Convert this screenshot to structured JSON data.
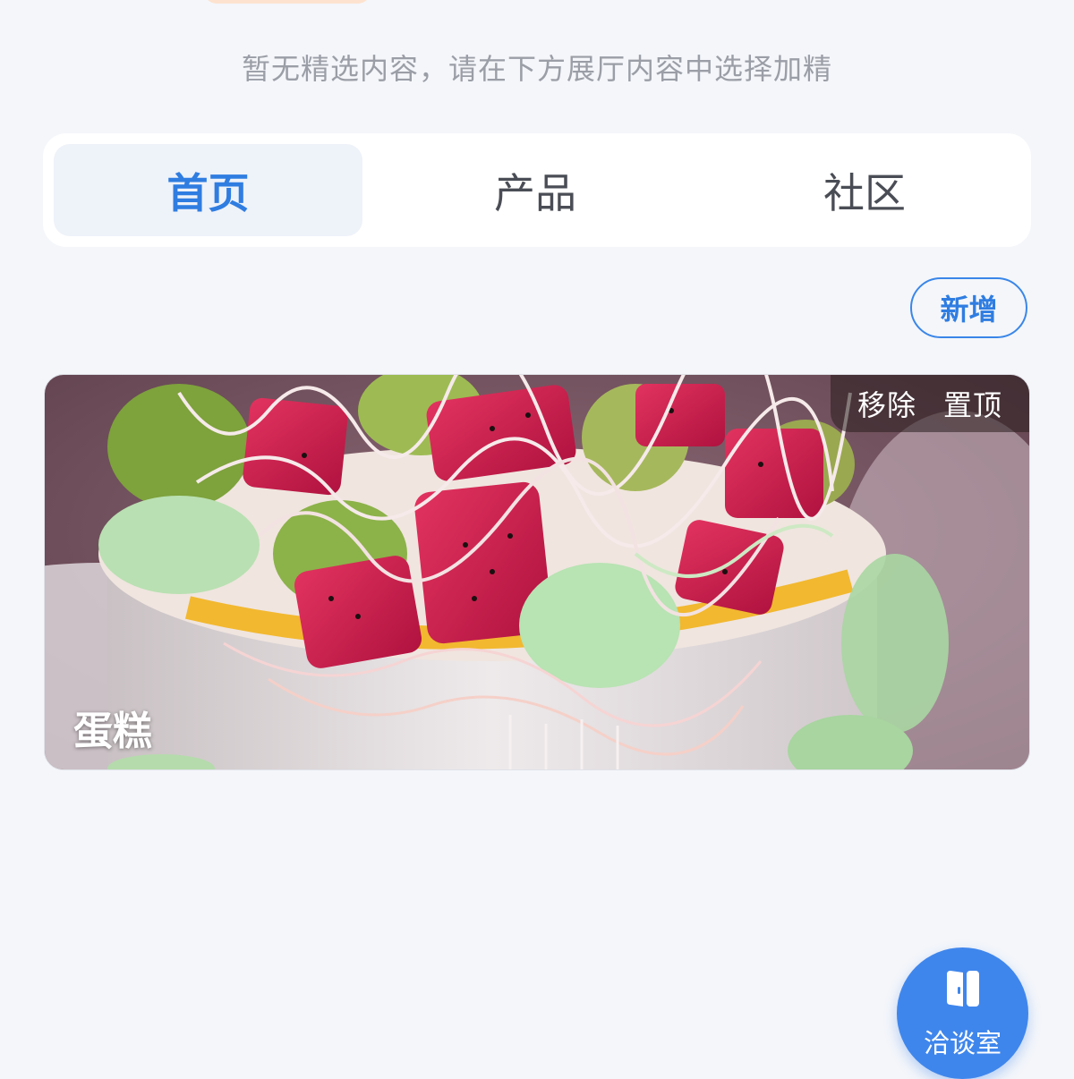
{
  "empty_hint": "暂无精选内容，请在下方展厅内容中选择加精",
  "tabs": [
    {
      "label": "首页",
      "active": true
    },
    {
      "label": "产品",
      "active": false
    },
    {
      "label": "社区",
      "active": false
    }
  ],
  "add_label": "新增",
  "card": {
    "title": "蛋糕",
    "remove_label": "移除",
    "pin_label": "置顶"
  },
  "fab": {
    "label": "洽谈室",
    "icon": "door-icon"
  },
  "colors": {
    "accent": "#2f7de1",
    "background": "#f4f6fa",
    "fab": "#3f86ec",
    "top_pill": "#fde3cf"
  }
}
